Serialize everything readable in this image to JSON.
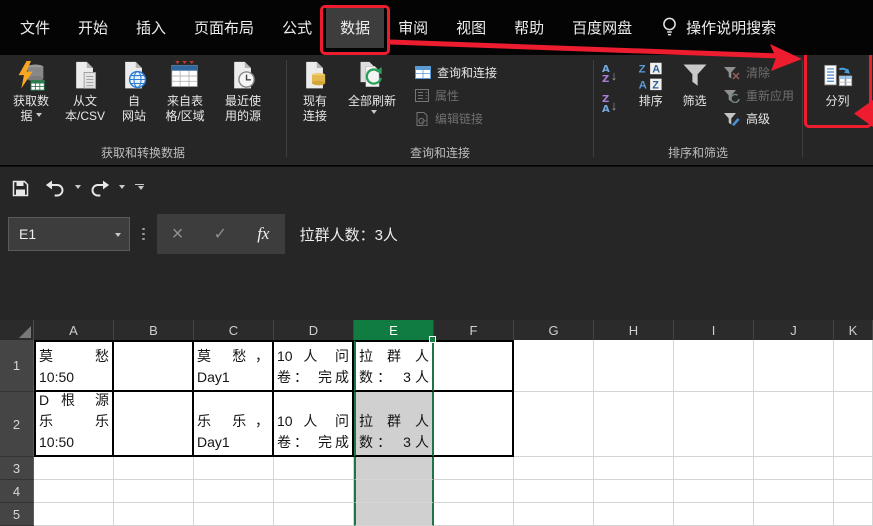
{
  "colors": {
    "annotation_red": "#ed1c2e",
    "selection_green": "#107c41"
  },
  "menubar": {
    "tabs": [
      {
        "label": "文件",
        "active": false
      },
      {
        "label": "开始",
        "active": false
      },
      {
        "label": "插入",
        "active": false
      },
      {
        "label": "页面布局",
        "active": false
      },
      {
        "label": "公式",
        "active": false
      },
      {
        "label": "数据",
        "active": true
      },
      {
        "label": "审阅",
        "active": false
      },
      {
        "label": "视图",
        "active": false
      },
      {
        "label": "帮助",
        "active": false
      },
      {
        "label": "百度网盘",
        "active": false
      }
    ],
    "search_label": "操作说明搜索"
  },
  "ribbon": {
    "get_data": "获取数\n据",
    "from_text": "从文\n本/CSV",
    "from_web": "自\n网站",
    "from_table": "来自表\n格/区域",
    "recent_sources": "最近使\n用的源",
    "existing_connections": "现有\n连接",
    "refresh_all": "全部刷新",
    "queries_connections": "查询和连接",
    "properties": "属性",
    "edit_links": "编辑链接",
    "sort": "排序",
    "filter": "筛选",
    "clear": "清除",
    "reapply": "重新应用",
    "advanced": "高级",
    "text_to_columns": "分列",
    "group_labels": {
      "get_transform": "获取和转换数据",
      "queries": "查询和连接",
      "sort_filter": "排序和筛选"
    }
  },
  "formula_bar": {
    "name_box": "E1",
    "content": "拉群人数：3人"
  },
  "sheet": {
    "columns": [
      "A",
      "B",
      "C",
      "D",
      "E",
      "F",
      "G",
      "H",
      "I",
      "J",
      "K"
    ],
    "selected_column": "E",
    "active_cell": "E1",
    "rows": [
      {
        "num": "1",
        "cells": {
          "A": [
            "莫 愁",
            "10:50"
          ],
          "C": [
            "莫 愁，",
            "Day1"
          ],
          "D": [
            "10 人 问",
            "卷： 完成"
          ],
          "E": [
            "拉 群 人",
            "数： 3人"
          ]
        }
      },
      {
        "num": "2",
        "cells": {
          "A": [
            "D 根 源",
            "乐 乐",
            "10:50"
          ],
          "C": [
            "乐 乐，",
            "Day1"
          ],
          "D": [
            "10 人 问",
            "卷： 完成"
          ],
          "E": [
            "拉 群 人",
            "数： 3人"
          ]
        }
      },
      {
        "num": "3",
        "cells": {}
      },
      {
        "num": "4",
        "cells": {}
      },
      {
        "num": "5",
        "cells": {}
      }
    ]
  }
}
